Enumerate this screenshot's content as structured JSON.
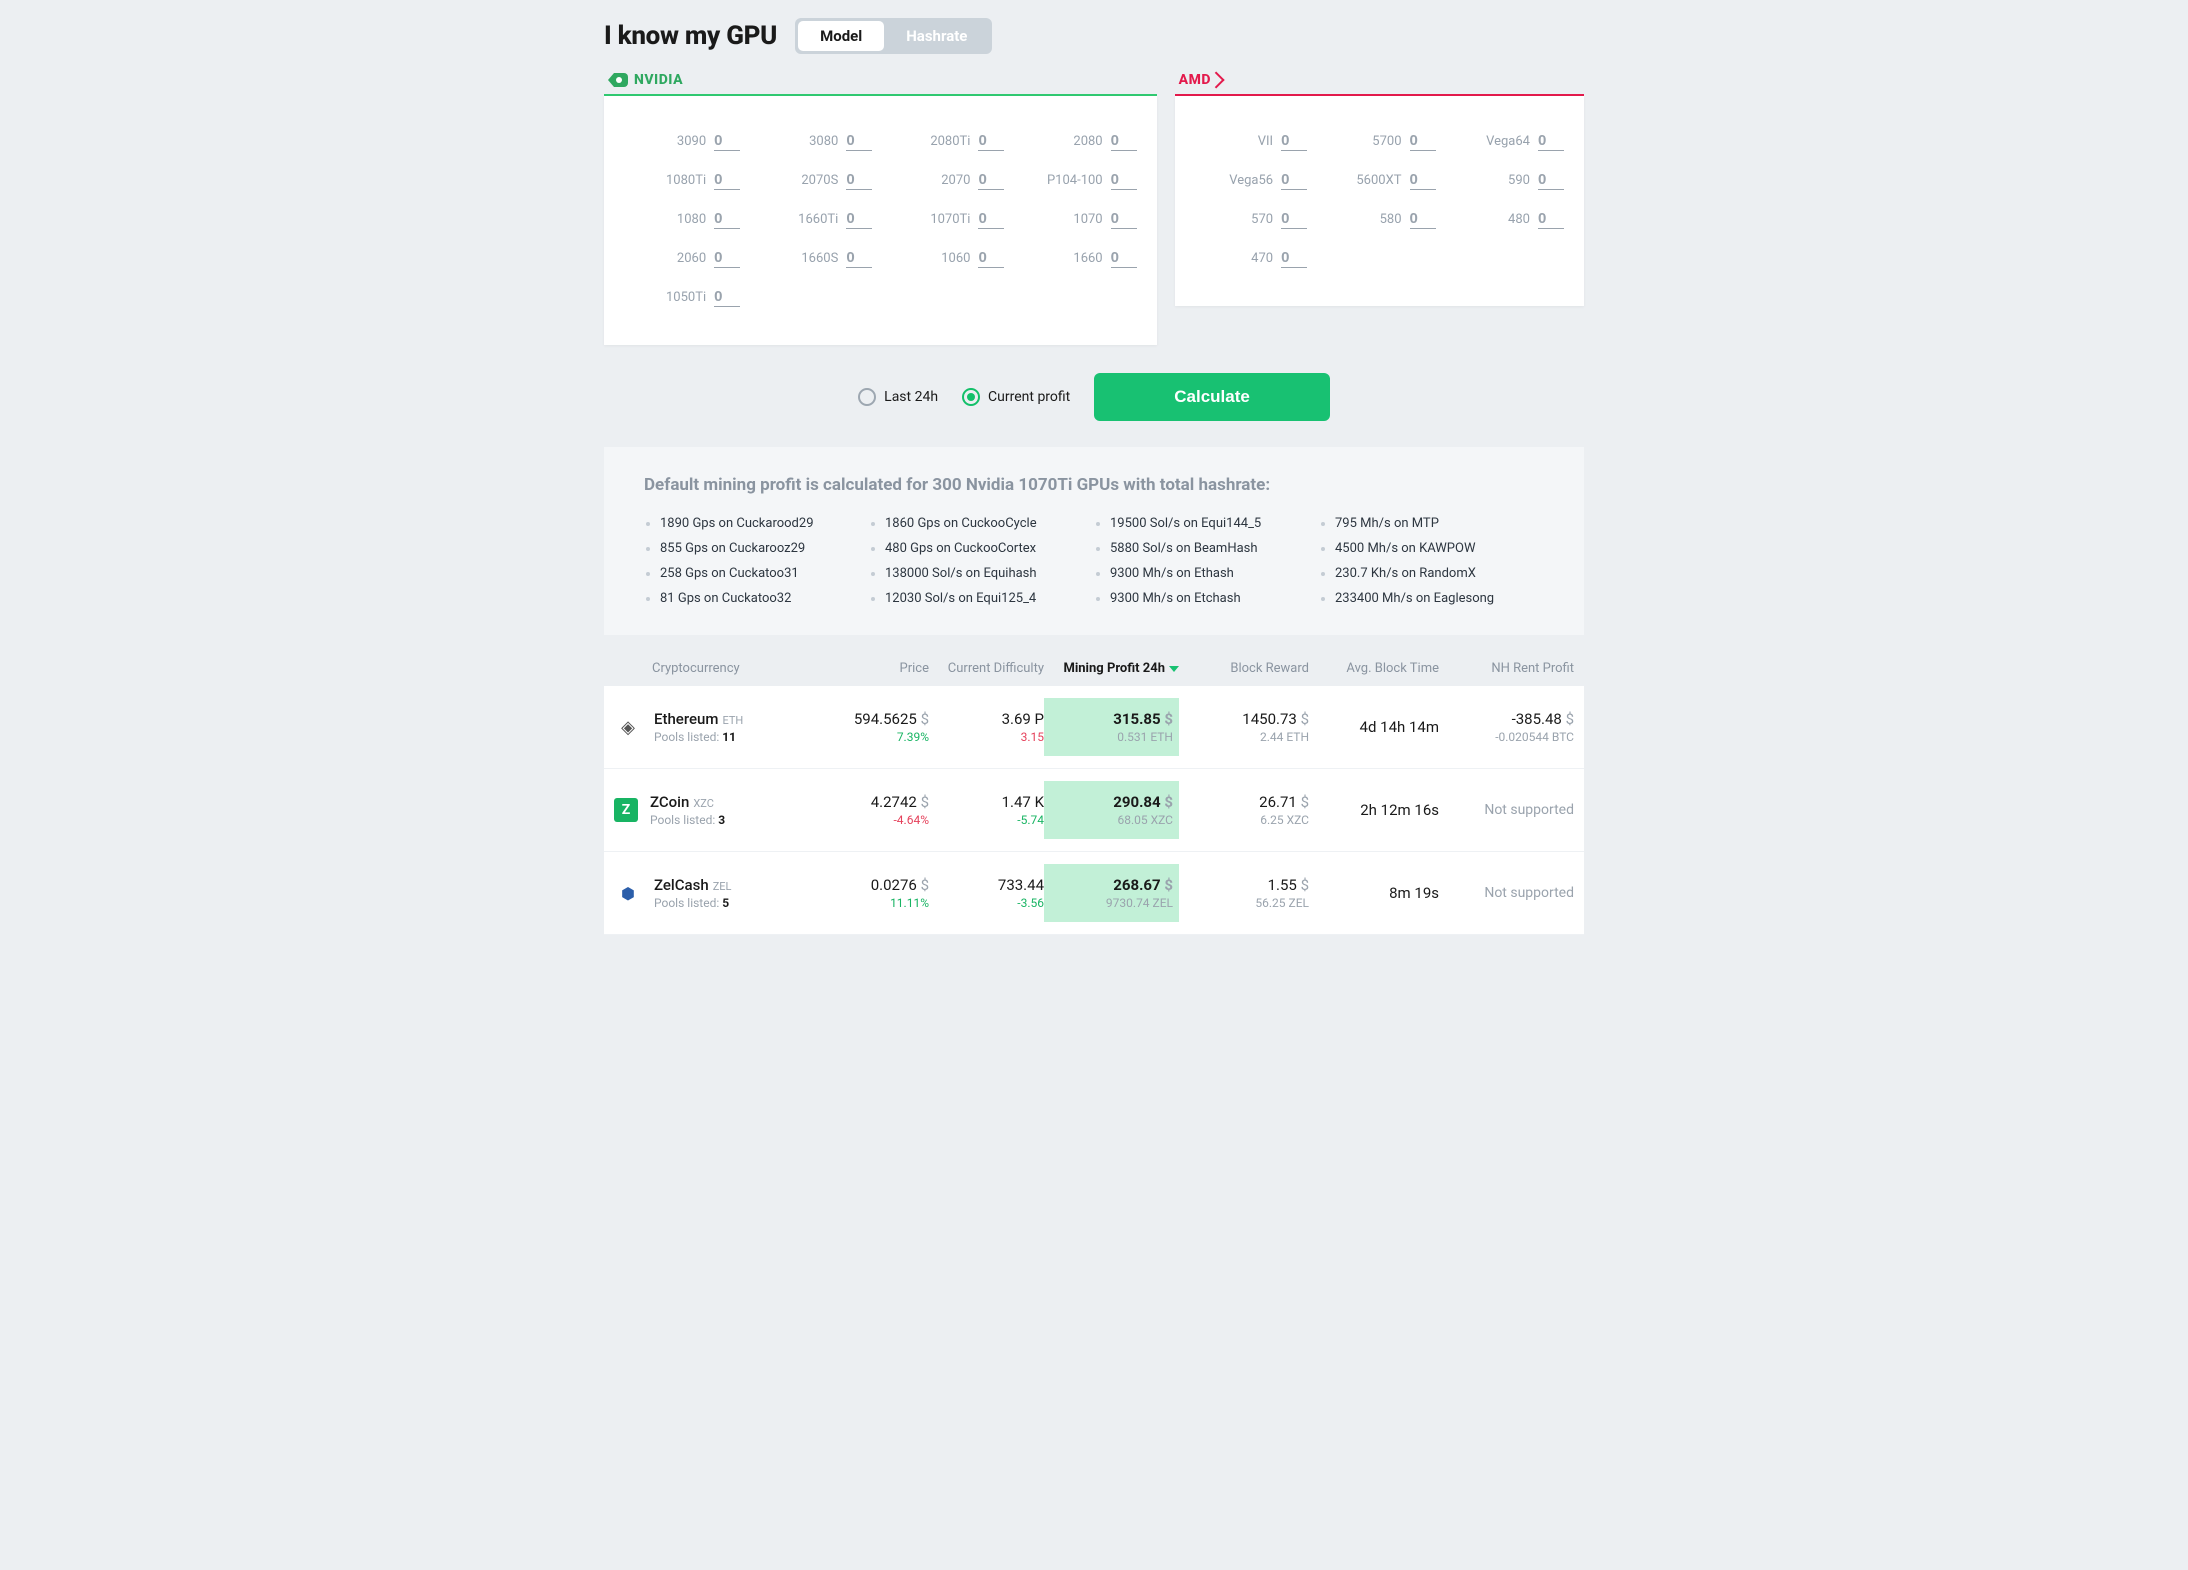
{
  "header": {
    "title": "I know my GPU",
    "toggle": {
      "model": "Model",
      "hashrate": "Hashrate",
      "active": "model"
    }
  },
  "brands": {
    "nvidia_label": "NVIDIA",
    "amd_label": "AMD"
  },
  "nvidia_gpus": [
    {
      "label": "3090",
      "value": "0"
    },
    {
      "label": "3080",
      "value": "0"
    },
    {
      "label": "2080Ti",
      "value": "0"
    },
    {
      "label": "2080",
      "value": "0"
    },
    {
      "label": "1080Ti",
      "value": "0"
    },
    {
      "label": "2070S",
      "value": "0"
    },
    {
      "label": "2070",
      "value": "0"
    },
    {
      "label": "P104-100",
      "value": "0"
    },
    {
      "label": "1080",
      "value": "0"
    },
    {
      "label": "1660Ti",
      "value": "0"
    },
    {
      "label": "1070Ti",
      "value": "0"
    },
    {
      "label": "1070",
      "value": "0"
    },
    {
      "label": "2060",
      "value": "0"
    },
    {
      "label": "1660S",
      "value": "0"
    },
    {
      "label": "1060",
      "value": "0"
    },
    {
      "label": "1660",
      "value": "0"
    },
    {
      "label": "1050Ti",
      "value": "0"
    }
  ],
  "amd_gpus": [
    {
      "label": "VII",
      "value": "0"
    },
    {
      "label": "5700",
      "value": "0"
    },
    {
      "label": "Vega64",
      "value": "0"
    },
    {
      "label": "Vega56",
      "value": "0"
    },
    {
      "label": "5600XT",
      "value": "0"
    },
    {
      "label": "590",
      "value": "0"
    },
    {
      "label": "570",
      "value": "0"
    },
    {
      "label": "580",
      "value": "0"
    },
    {
      "label": "480",
      "value": "0"
    },
    {
      "label": "470",
      "value": "0"
    }
  ],
  "calc": {
    "last24h": "Last 24h",
    "current": "Current profit",
    "selected": "current",
    "button": "Calculate"
  },
  "hashrate_info": {
    "heading": "Default mining profit is calculated for 300 Nvidia 1070Ti GPUs with total hashrate:",
    "items": [
      "1890 Gps on Cuckarood29",
      "1860 Gps on CuckooCycle",
      "19500 Sol/s on Equi144_5",
      "795 Mh/s on MTP",
      "855 Gps on Cuckarooz29",
      "480 Gps on CuckooCortex",
      "5880 Sol/s on BeamHash",
      "4500 Mh/s on KAWPOW",
      "258 Gps on Cuckatoo31",
      "138000 Sol/s on Equihash",
      "9300 Mh/s on Ethash",
      "230.7 Kh/s on RandomX",
      "81 Gps on Cuckatoo32",
      "12030 Sol/s on Equi125_4",
      "9300 Mh/s on Etchash",
      "233400 Mh/s on Eaglesong"
    ]
  },
  "columns": {
    "crypto": "Cryptocurrency",
    "price": "Price",
    "difficulty": "Current Difficulty",
    "profit": "Mining Profit 24h",
    "reward": "Block Reward",
    "blocktime": "Avg. Block Time",
    "nhrent": "NH Rent Profit"
  },
  "pools_label": "Pools listed:",
  "coins": [
    {
      "name": "Ethereum",
      "ticker": "ETH",
      "pools": "11",
      "price": "594.5625",
      "price_unit": "$",
      "price_change": "7.39%",
      "price_dir": "green",
      "diff": "3.69 P",
      "diff_change": "3.15",
      "diff_dir": "red",
      "profit": "315.85",
      "profit_unit": "$",
      "profit_sub": "0.531 ETH",
      "reward": "1450.73",
      "reward_unit": "$",
      "reward_sub": "2.44 ETH",
      "block_time": "4d 14h 14m",
      "nh": "-385.48",
      "nh_unit": "$",
      "nh_sub": "-0.020544 BTC",
      "nh_supported": true,
      "icon": "eth"
    },
    {
      "name": "ZCoin",
      "ticker": "XZC",
      "pools": "3",
      "price": "4.2742",
      "price_unit": "$",
      "price_change": "-4.64%",
      "price_dir": "red",
      "diff": "1.47 K",
      "diff_change": "-5.74",
      "diff_dir": "green",
      "profit": "290.84",
      "profit_unit": "$",
      "profit_sub": "68.05 XZC",
      "reward": "26.71",
      "reward_unit": "$",
      "reward_sub": "6.25 XZC",
      "block_time": "2h 12m 16s",
      "nh": "Not supported",
      "nh_supported": false,
      "icon": "xzc"
    },
    {
      "name": "ZelCash",
      "ticker": "ZEL",
      "pools": "5",
      "price": "0.0276",
      "price_unit": "$",
      "price_change": "11.11%",
      "price_dir": "green",
      "diff": "733.44",
      "diff_change": "-3.56",
      "diff_dir": "green",
      "profit": "268.67",
      "profit_unit": "$",
      "profit_sub": "9730.74 ZEL",
      "reward": "1.55",
      "reward_unit": "$",
      "reward_sub": "56.25 ZEL",
      "block_time": "8m 19s",
      "nh": "Not supported",
      "nh_supported": false,
      "icon": "zel"
    }
  ]
}
